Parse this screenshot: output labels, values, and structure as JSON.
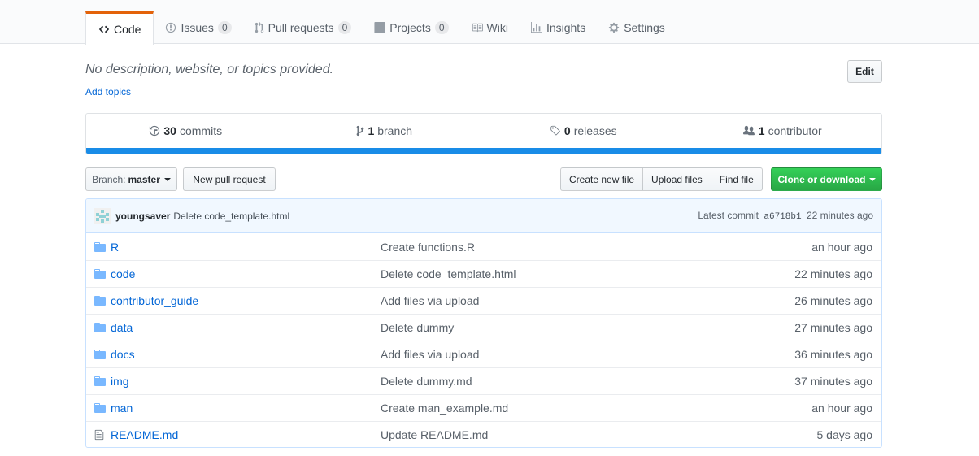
{
  "tabs": [
    {
      "label": "Code",
      "counter": "",
      "icon": "code-icon"
    },
    {
      "label": "Issues",
      "counter": "0",
      "icon": "issue-icon"
    },
    {
      "label": "Pull requests",
      "counter": "0",
      "icon": "pull-request-icon"
    },
    {
      "label": "Projects",
      "counter": "0",
      "icon": "project-icon"
    },
    {
      "label": "Wiki",
      "counter": "",
      "icon": "book-icon"
    },
    {
      "label": "Insights",
      "counter": "",
      "icon": "graph-icon"
    },
    {
      "label": "Settings",
      "counter": "",
      "icon": "gear-icon"
    }
  ],
  "repo": {
    "description": "No description, website, or topics provided.",
    "add_topics": "Add topics",
    "edit_label": "Edit"
  },
  "summary": {
    "commits": {
      "num": "30",
      "label": "commits"
    },
    "branches": {
      "num": "1",
      "label": "branch"
    },
    "releases": {
      "num": "0",
      "label": "releases"
    },
    "contributors": {
      "num": "1",
      "label": "contributor"
    }
  },
  "toolbar": {
    "branch_prefix": "Branch:",
    "branch_name": "master",
    "new_pull_request": "New pull request",
    "create_new_file": "Create new file",
    "upload_files": "Upload files",
    "find_file": "Find file",
    "clone_download": "Clone or download"
  },
  "latest_commit": {
    "author": "youngsaver",
    "message": "Delete code_template.html",
    "prefix": "Latest commit",
    "sha": "a6718b1",
    "age": "22 minutes ago"
  },
  "files": [
    {
      "type": "folder",
      "name": "R",
      "message": "Create functions.R",
      "age": "an hour ago"
    },
    {
      "type": "folder",
      "name": "code",
      "message": "Delete code_template.html",
      "age": "22 minutes ago"
    },
    {
      "type": "folder",
      "name": "contributor_guide",
      "message": "Add files via upload",
      "age": "26 minutes ago"
    },
    {
      "type": "folder",
      "name": "data",
      "message": "Delete dummy",
      "age": "27 minutes ago"
    },
    {
      "type": "folder",
      "name": "docs",
      "message": "Add files via upload",
      "age": "36 minutes ago"
    },
    {
      "type": "folder",
      "name": "img",
      "message": "Delete dummy.md",
      "age": "37 minutes ago"
    },
    {
      "type": "folder",
      "name": "man",
      "message": "Create man_example.md",
      "age": "an hour ago"
    },
    {
      "type": "file",
      "name": "README.md",
      "message": "Update README.md",
      "age": "5 days ago"
    }
  ],
  "colors": {
    "link": "#0366d6",
    "accent_tab": "#e36209",
    "language_bar": "#198ce7",
    "clone_button": "#28a745"
  }
}
